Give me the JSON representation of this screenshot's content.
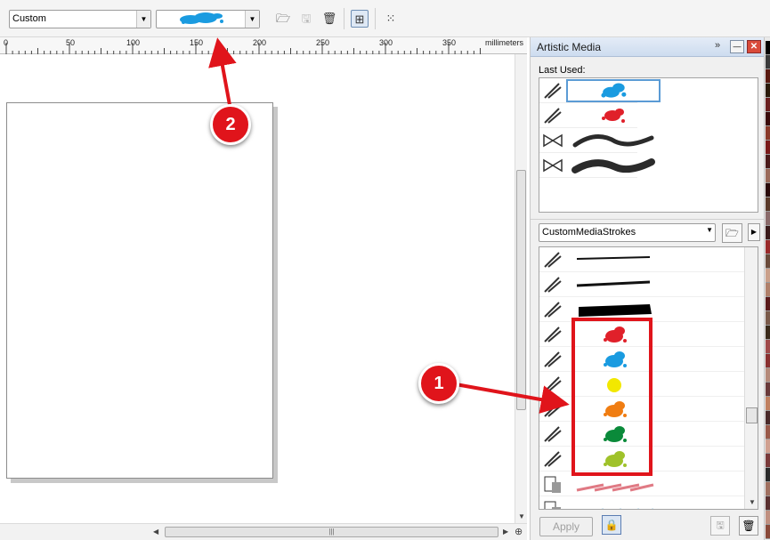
{
  "propbar": {
    "preset_value": "Custom",
    "stroke_preview": "blue splatter stroke",
    "icons": [
      "folder-open-icon",
      "save-icon",
      "delete-icon",
      "scale-with-image-icon",
      "bounding-box-icon"
    ]
  },
  "ruler": {
    "ticks": [
      "0",
      "50",
      "100",
      "150",
      "200",
      "250",
      "300",
      "350"
    ],
    "unit": "millimeters"
  },
  "docker": {
    "title": "Artistic Media",
    "last_used_label": "Last Used:",
    "last_used": [
      {
        "type": "sprayer",
        "stroke": "blue splatter",
        "color": "#1a9be0",
        "selected": true
      },
      {
        "type": "sprayer",
        "stroke": "red splatter",
        "color": "#e0202a",
        "selected": false
      },
      {
        "type": "brush",
        "stroke": "calligraphic wave",
        "color": "#2b2b2b",
        "selected": false
      },
      {
        "type": "brush",
        "stroke": "thick wave",
        "color": "#2b2b2b",
        "selected": false
      }
    ],
    "library_value": "CustomMediaStrokes",
    "strokes": [
      {
        "kind": "thin-line",
        "color": "#111111"
      },
      {
        "kind": "rough-line",
        "color": "#111111"
      },
      {
        "kind": "thick-bar",
        "color": "#000000"
      },
      {
        "kind": "splat",
        "color": "#e0202a"
      },
      {
        "kind": "splat",
        "color": "#1a9be0"
      },
      {
        "kind": "dot",
        "color": "#f2e800"
      },
      {
        "kind": "splat",
        "color": "#f07d12"
      },
      {
        "kind": "splat",
        "color": "#0a8a3a"
      },
      {
        "kind": "splat",
        "color": "#9fc22a"
      },
      {
        "kind": "pencils",
        "color": "#e07a84"
      },
      {
        "kind": "pencils",
        "color": "#7ab6d8"
      }
    ],
    "apply_label": "Apply"
  },
  "palette": {
    "colors": [
      "#000000",
      "#3a3a3a",
      "#5a1a10",
      "#2a1a0a",
      "#6a2020",
      "#3a0a0a",
      "#8a3a2a",
      "#7a1a1a",
      "#4a1a1a",
      "#9a6a5a",
      "#2a0a0a",
      "#5a3a2a",
      "#8a6a6a",
      "#3a1a1a",
      "#9a2a2a",
      "#6a4a3a",
      "#caa08a",
      "#b0806a",
      "#5a1a1a",
      "#7a5a4a",
      "#3a2a1a",
      "#a04a4a",
      "#8a3030",
      "#b58a7a",
      "#6a3a3a",
      "#c08060",
      "#4a2a2a",
      "#9a5a4a",
      "#d0a090",
      "#7a3a3a",
      "#2a2a2a",
      "#a07060",
      "#5a3030",
      "#c09080",
      "#8a4a3a"
    ]
  },
  "annotations": {
    "marker_1": "1",
    "marker_2": "2"
  },
  "colors": {
    "annotation_red": "#e0141b",
    "selection_blue": "#5b9bd5"
  }
}
